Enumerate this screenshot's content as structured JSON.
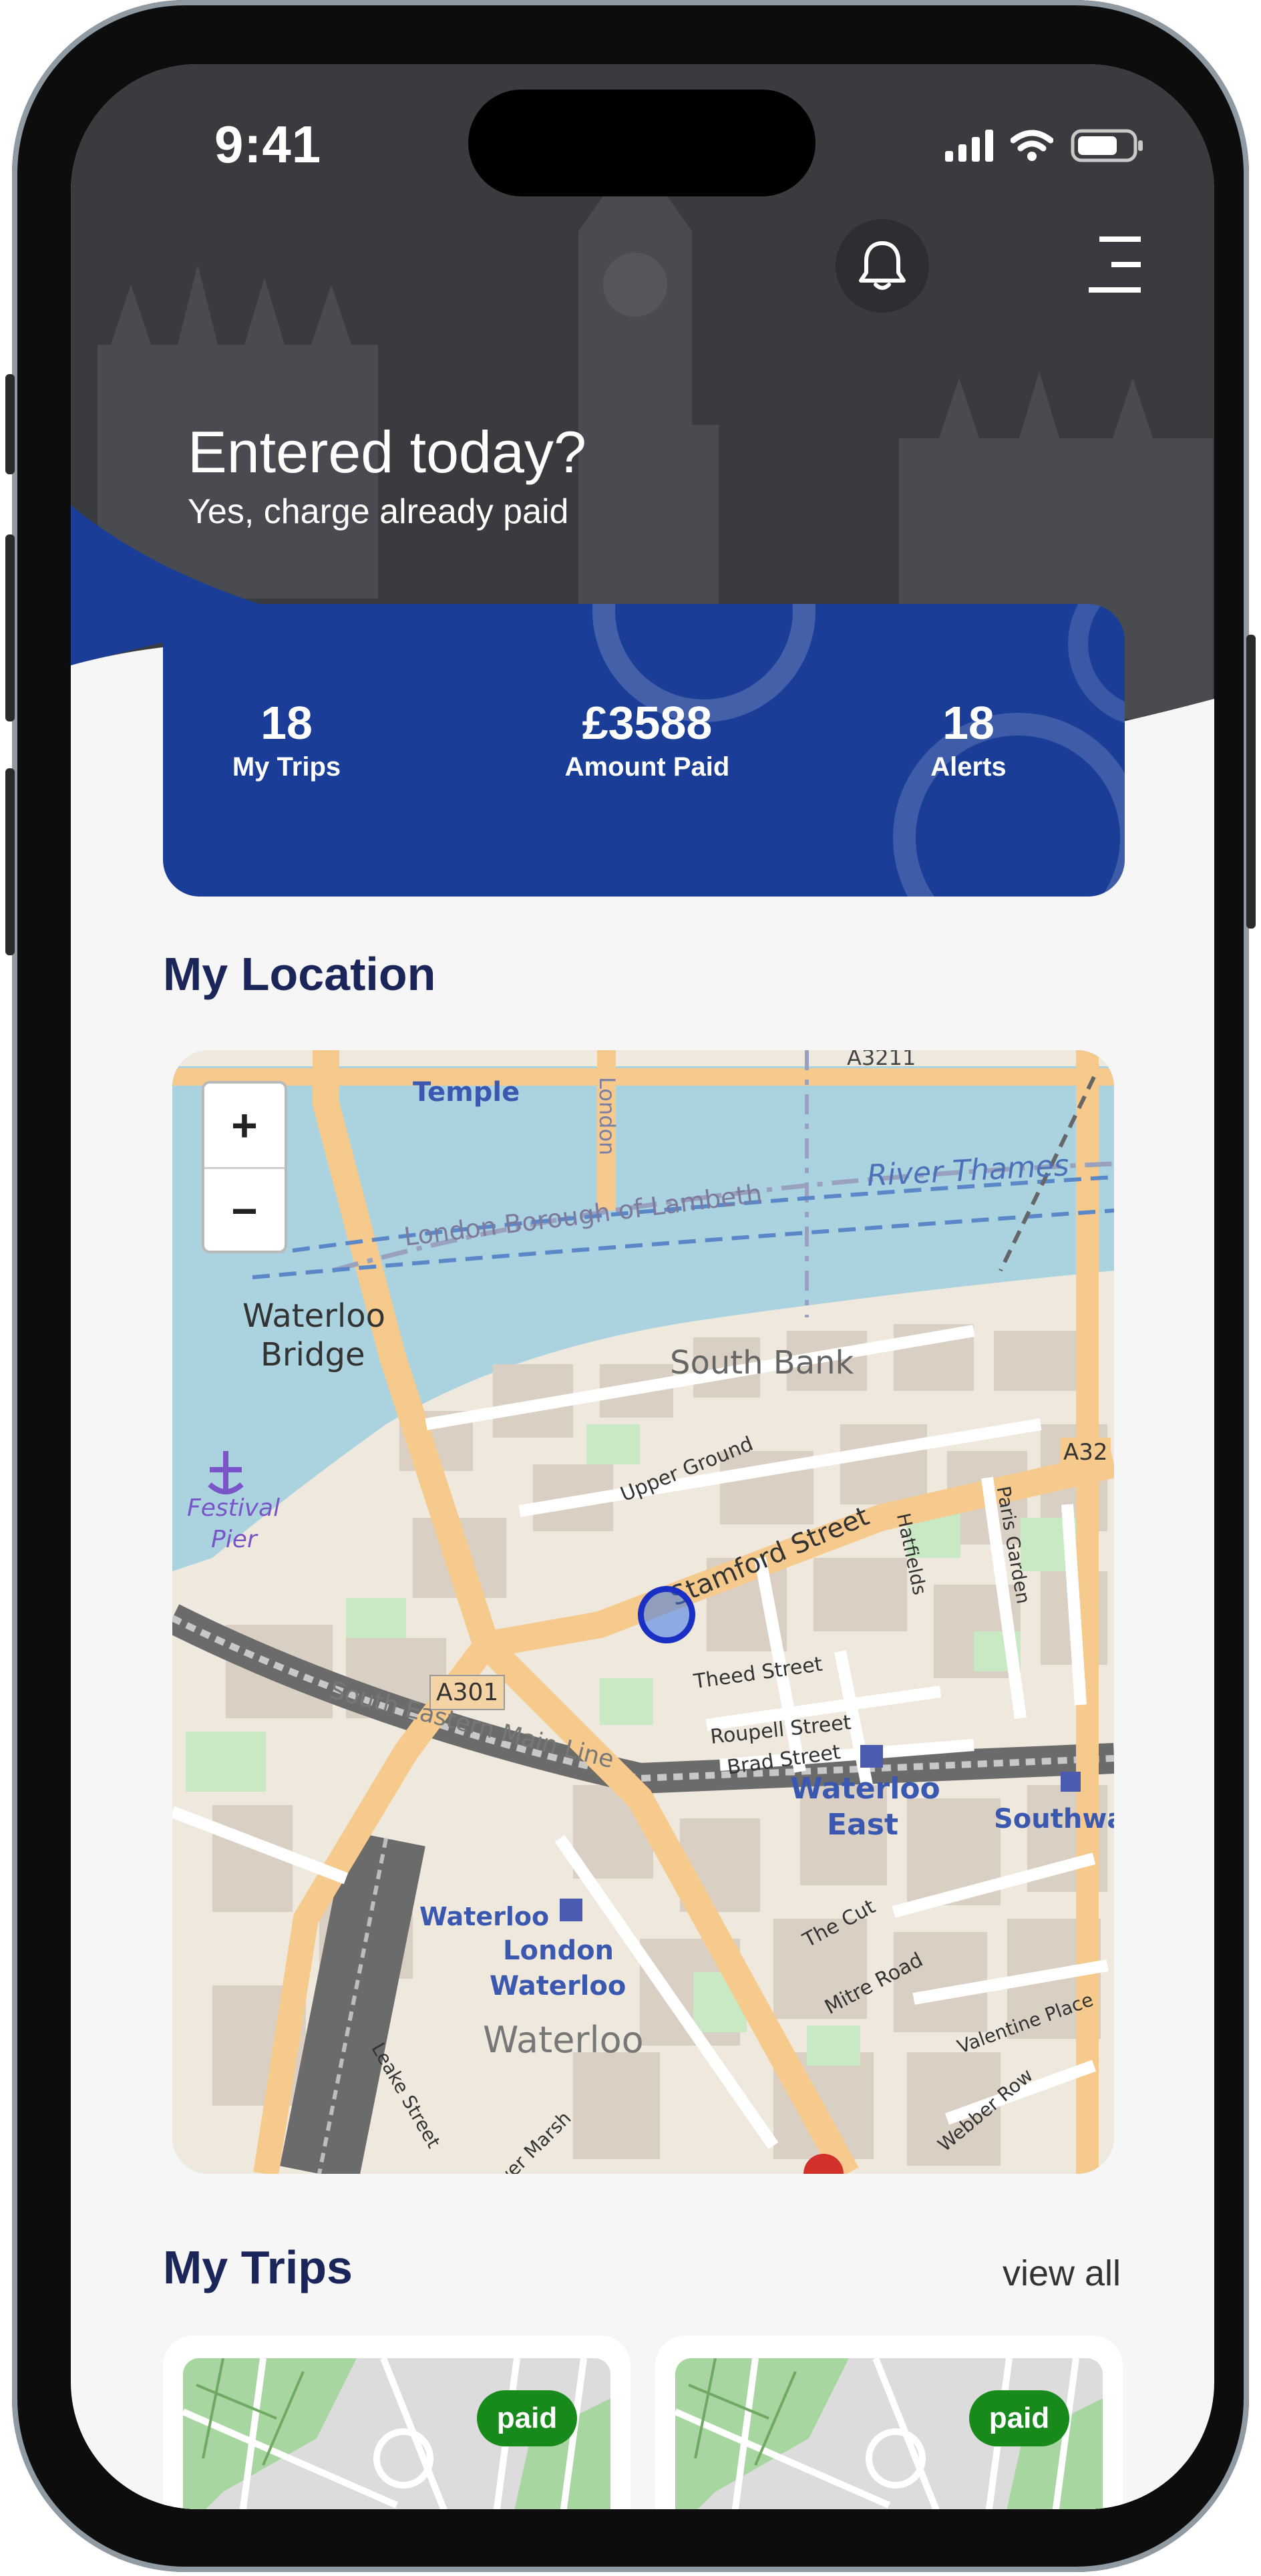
{
  "status_bar": {
    "time": "9:41"
  },
  "hero": {
    "title": "Entered today?",
    "subtitle": "Yes, charge already paid"
  },
  "stats": [
    {
      "value": "18",
      "label": "My Trips"
    },
    {
      "value": "£3588",
      "label": "Amount Paid"
    },
    {
      "value": "18",
      "label": "Alerts"
    }
  ],
  "location": {
    "title": "My Location",
    "zoom_in": "+",
    "zoom_out": "−",
    "map_labels": {
      "temple": "Temple",
      "river": "River Thames",
      "lambeth": "London Borough of Lambeth",
      "waterloo_bridge_1": "Waterloo",
      "waterloo_bridge_2": "Bridge",
      "south_bank": "South Bank",
      "festival_1": "Festival",
      "festival_2": "Pier",
      "upper_ground": "Upper Ground",
      "stamford": "Stamford Street",
      "hatfields": "Hatfields",
      "paris_garden": "Paris Garden",
      "a301": "A301",
      "a3211": "A3211",
      "a32": "A32",
      "theed": "Theed Street",
      "roupell": "Roupell Street",
      "brad": "Brad Street",
      "south_eastern": "South Eastern Main Line",
      "waterloo_east_1": "Waterloo",
      "waterloo_east_2": "East",
      "southwark": "Southwa",
      "the_cut": "The Cut",
      "mitre": "Mitre Road",
      "valentine": "Valentine Place",
      "webber": "Webber Row",
      "waterloo_st": "Waterloo",
      "london_1": "London",
      "london_2": "Waterloo",
      "waterloo_area": "Waterloo",
      "leake": "Leake Street",
      "lower_marsh": "Lower Marsh",
      "london_v": "London"
    }
  },
  "trips": {
    "title": "My Trips",
    "view_all": "view all",
    "cards": [
      {
        "badge": "paid"
      },
      {
        "badge": "paid"
      }
    ]
  },
  "colors": {
    "brand_blue": "#1a3d97",
    "heading_navy": "#1a2559",
    "paid_green": "#188a1c",
    "hero_dark": "#3b3c40"
  },
  "icons": [
    "bell-icon",
    "menu-icon",
    "signal-icon",
    "wifi-icon",
    "battery-icon",
    "location-marker-icon"
  ]
}
